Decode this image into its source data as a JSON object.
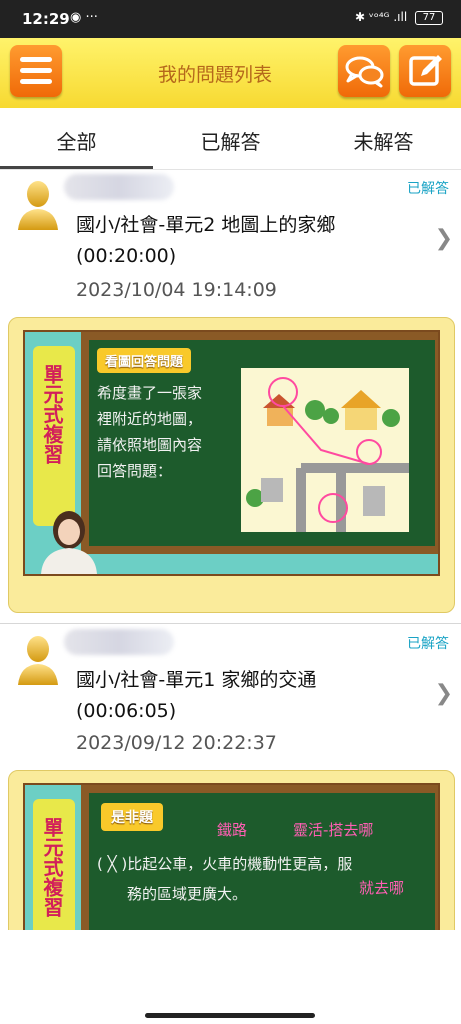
{
  "status_bar": {
    "time": "12:29",
    "left_icons": "◉ ···",
    "signal": "✱ ᵛᵒ⁴ᴳ .ıll",
    "battery": "77"
  },
  "header": {
    "title": "我的問題列表"
  },
  "tabs": [
    {
      "label": "全部",
      "selected": true
    },
    {
      "label": "已解答",
      "selected": false
    },
    {
      "label": "未解答",
      "selected": false
    }
  ],
  "questions": [
    {
      "status": "已解答",
      "title_line1": "國小/社會-單元2 地圖上的家鄉",
      "title_line2": "(00:20:00)",
      "datetime": "2023/10/04 19:14:09",
      "thumb": {
        "side_label": "單元式複習",
        "board_heading": "看圖回答問題",
        "board_text": [
          "希度畫了一張家",
          "裡附近的地圖，",
          "請依照地圖內容",
          "回答問題："
        ]
      }
    },
    {
      "status": "已解答",
      "title_line1": "國小/社會-單元1 家鄉的交通",
      "title_line2": "(00:06:05)",
      "datetime": "2023/09/12 20:22:37",
      "thumb": {
        "side_label": "單元式複習",
        "board_heading": "是非題",
        "board_text": [
          "(  ╳ )比起公車，火車的機動性更高，服",
          "務的區域更廣大。"
        ],
        "handwriting": [
          "鐵路",
          "靈活-搭去哪",
          "就去哪"
        ]
      }
    }
  ],
  "colors": {
    "accent_orange": "#f07d12",
    "header_yellow": "#f9e04a",
    "answered_cyan": "#1aa3c5"
  }
}
